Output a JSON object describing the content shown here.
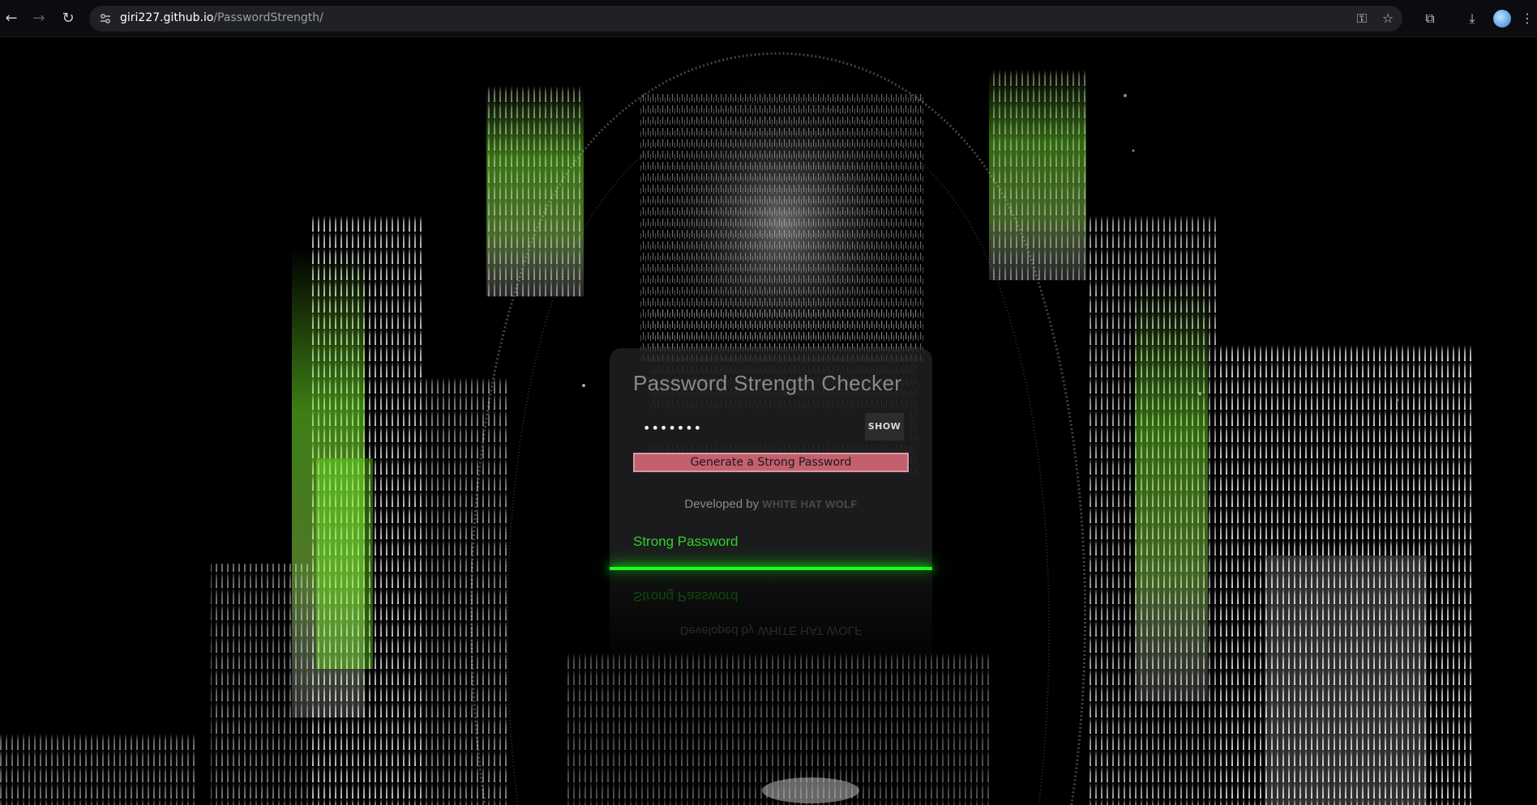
{
  "browser": {
    "url_host": "giri227.github.io",
    "url_path": "/PasswordStrength/",
    "back_icon": "←",
    "forward_icon": "→",
    "reload_icon": "↻",
    "key_icon": "⚿",
    "star_icon": "☆",
    "extensions_icon": "⧉",
    "download_icon": "⤓",
    "menu_icon": "⋮"
  },
  "card": {
    "title": "Password Strength Checker",
    "password_value": "•••••••",
    "show_label": "SHOW",
    "generate_label": "Generate a Strong Password",
    "credit_prefix": "Developed by",
    "credit_name": "WHITE HAT WOLF",
    "strength_text": "Strong Password"
  },
  "colors": {
    "accent_green": "#18ff18",
    "strength_text": "#2cd42c",
    "generate_button": "#c4606e"
  }
}
